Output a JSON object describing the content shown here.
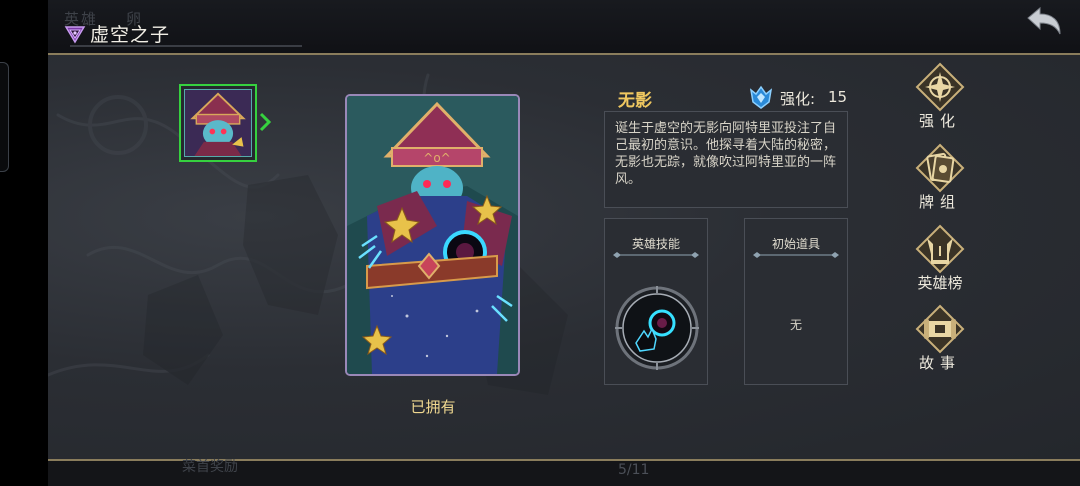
{
  "header": {
    "title": "虚空之子",
    "ghost_tab_1": "英雄",
    "ghost_tab_2": "卵"
  },
  "hero": {
    "name": "无影",
    "enhance_label": "强化:",
    "enhance_value": "15",
    "description": "诞生于虚空的无影向阿特里亚投注了自己最初的意识。他探寻着大陆的秘密，无影也无踪，就像吹过阿特里亚的一阵风。",
    "status": "已拥有"
  },
  "skill_panel": {
    "title": "英雄技能",
    "icon": "void-hand-orb-icon"
  },
  "item_panel": {
    "title": "初始道具",
    "value": "无"
  },
  "menu": [
    {
      "label": "强化",
      "icon": "enhance-compass-icon"
    },
    {
      "label": "牌组",
      "icon": "deck-cards-icon"
    },
    {
      "label": "英雄榜",
      "icon": "leaderboard-helmet-icon"
    },
    {
      "label": "故事",
      "icon": "story-scroll-icon"
    }
  ],
  "footer": {
    "ghost_text": "菜首奖励",
    "page": "5/11"
  },
  "colors": {
    "accent_gold": "#f0c860",
    "selection_green": "#36d13f",
    "card_border": "#9a88b8",
    "divider_gold": "#8a7d5c"
  }
}
